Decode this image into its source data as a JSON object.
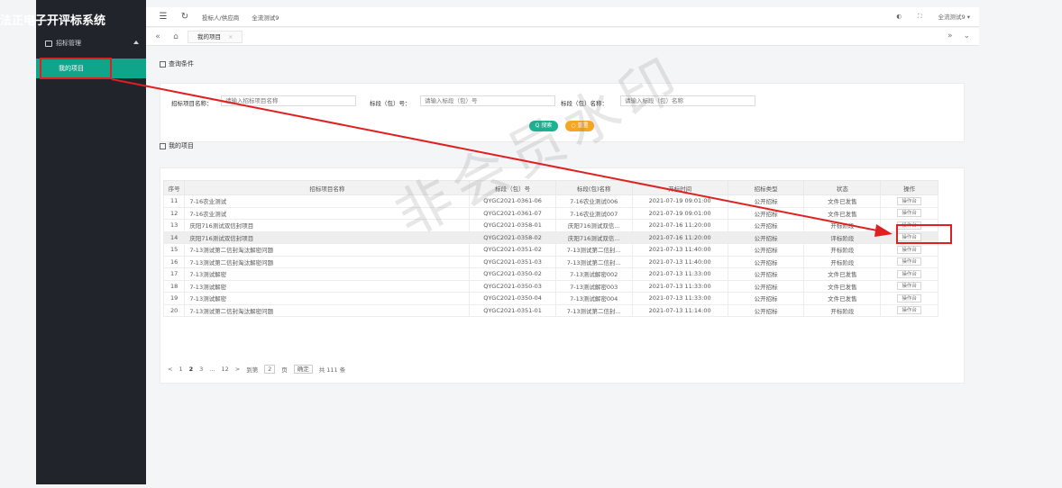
{
  "app": {
    "title": "法正电子开评标系统"
  },
  "sidebar": {
    "group_label": "招标管理",
    "active_item": "我的项目"
  },
  "topbar": {
    "link1": "投标人/供应商",
    "link2": "全流测试9",
    "user": "全流测试9 ▾"
  },
  "tabs": {
    "current": "我的项目"
  },
  "search": {
    "section_title": "查询条件",
    "label_name": "招标项目名称：",
    "placeholder_name": "请输入招标项目名称",
    "label_code": "标段（包）号：",
    "placeholder_code": "请输入标段（包）号",
    "label_pkgname": "标段（包）名称：",
    "placeholder_pkgname": "请输入标段（包）名称",
    "btn_search": "Q 搜索",
    "btn_reset": "○ 重置"
  },
  "projects": {
    "section_title": "我的项目",
    "headers": [
      "序号",
      "招标项目名称",
      "标段（包）号",
      "标段(包)名称",
      "开标时间",
      "招标类型",
      "状态",
      "操作"
    ],
    "op_label": "操作台",
    "rows": [
      [
        "11",
        "7-16农业测试",
        "QYGC2021-0361-06",
        "7-16农业测试006",
        "2021-07-19 09:01:00",
        "公开招标",
        "文件已发售"
      ],
      [
        "12",
        "7-16农业测试",
        "QYGC2021-0361-07",
        "7-16农业测试007",
        "2021-07-19 09:01:00",
        "公开招标",
        "文件已发售"
      ],
      [
        "13",
        "庆阳716测试双信封项目",
        "QYGC2021-0358-01",
        "庆阳716测试双信...",
        "2021-07-16 11:20:00",
        "公开招标",
        "开标阶段"
      ],
      [
        "14",
        "庆阳716测试双信封项目",
        "QYGC2021-0358-02",
        "庆阳716测试双信...",
        "2021-07-16 11:20:00",
        "公开招标",
        "评标阶段"
      ],
      [
        "15",
        "7-13测试第二信封淘汰解密问题",
        "QYGC2021-0351-02",
        "7-13测试第二信封...",
        "2021-07-13 11:40:00",
        "公开招标",
        "开标阶段"
      ],
      [
        "16",
        "7-13测试第二信封淘汰解密问题",
        "QYGC2021-0351-03",
        "7-13测试第二信封...",
        "2021-07-13 11:40:00",
        "公开招标",
        "开标阶段"
      ],
      [
        "17",
        "7-13测试解密",
        "QYGC2021-0350-02",
        "7-13测试解密002",
        "2021-07-13 11:33:00",
        "公开招标",
        "文件已发售"
      ],
      [
        "18",
        "7-13测试解密",
        "QYGC2021-0350-03",
        "7-13测试解密003",
        "2021-07-13 11:33:00",
        "公开招标",
        "文件已发售"
      ],
      [
        "19",
        "7-13测试解密",
        "QYGC2021-0350-04",
        "7-13测试解密004",
        "2021-07-13 11:33:00",
        "公开招标",
        "文件已发售"
      ],
      [
        "20",
        "7-13测试第二信封淘汰解密问题",
        "QYGC2021-0351-01",
        "7-13测试第二信封...",
        "2021-07-13 11:14:00",
        "公开招标",
        "开标阶段"
      ]
    ]
  },
  "pager": {
    "prev": "<",
    "p1": "1",
    "p2": "2",
    "p3": "3",
    "ellipsis": "...",
    "last": "12",
    "next": ">",
    "goto_label": "到第",
    "goto_value": "2",
    "page_unit": "页",
    "confirm": "确定",
    "total": "共 111 条"
  },
  "watermark": "非会员水印",
  "colors": {
    "accent": "#0ea58a",
    "sidebar": "#21242b",
    "annotation": "#e02020"
  }
}
